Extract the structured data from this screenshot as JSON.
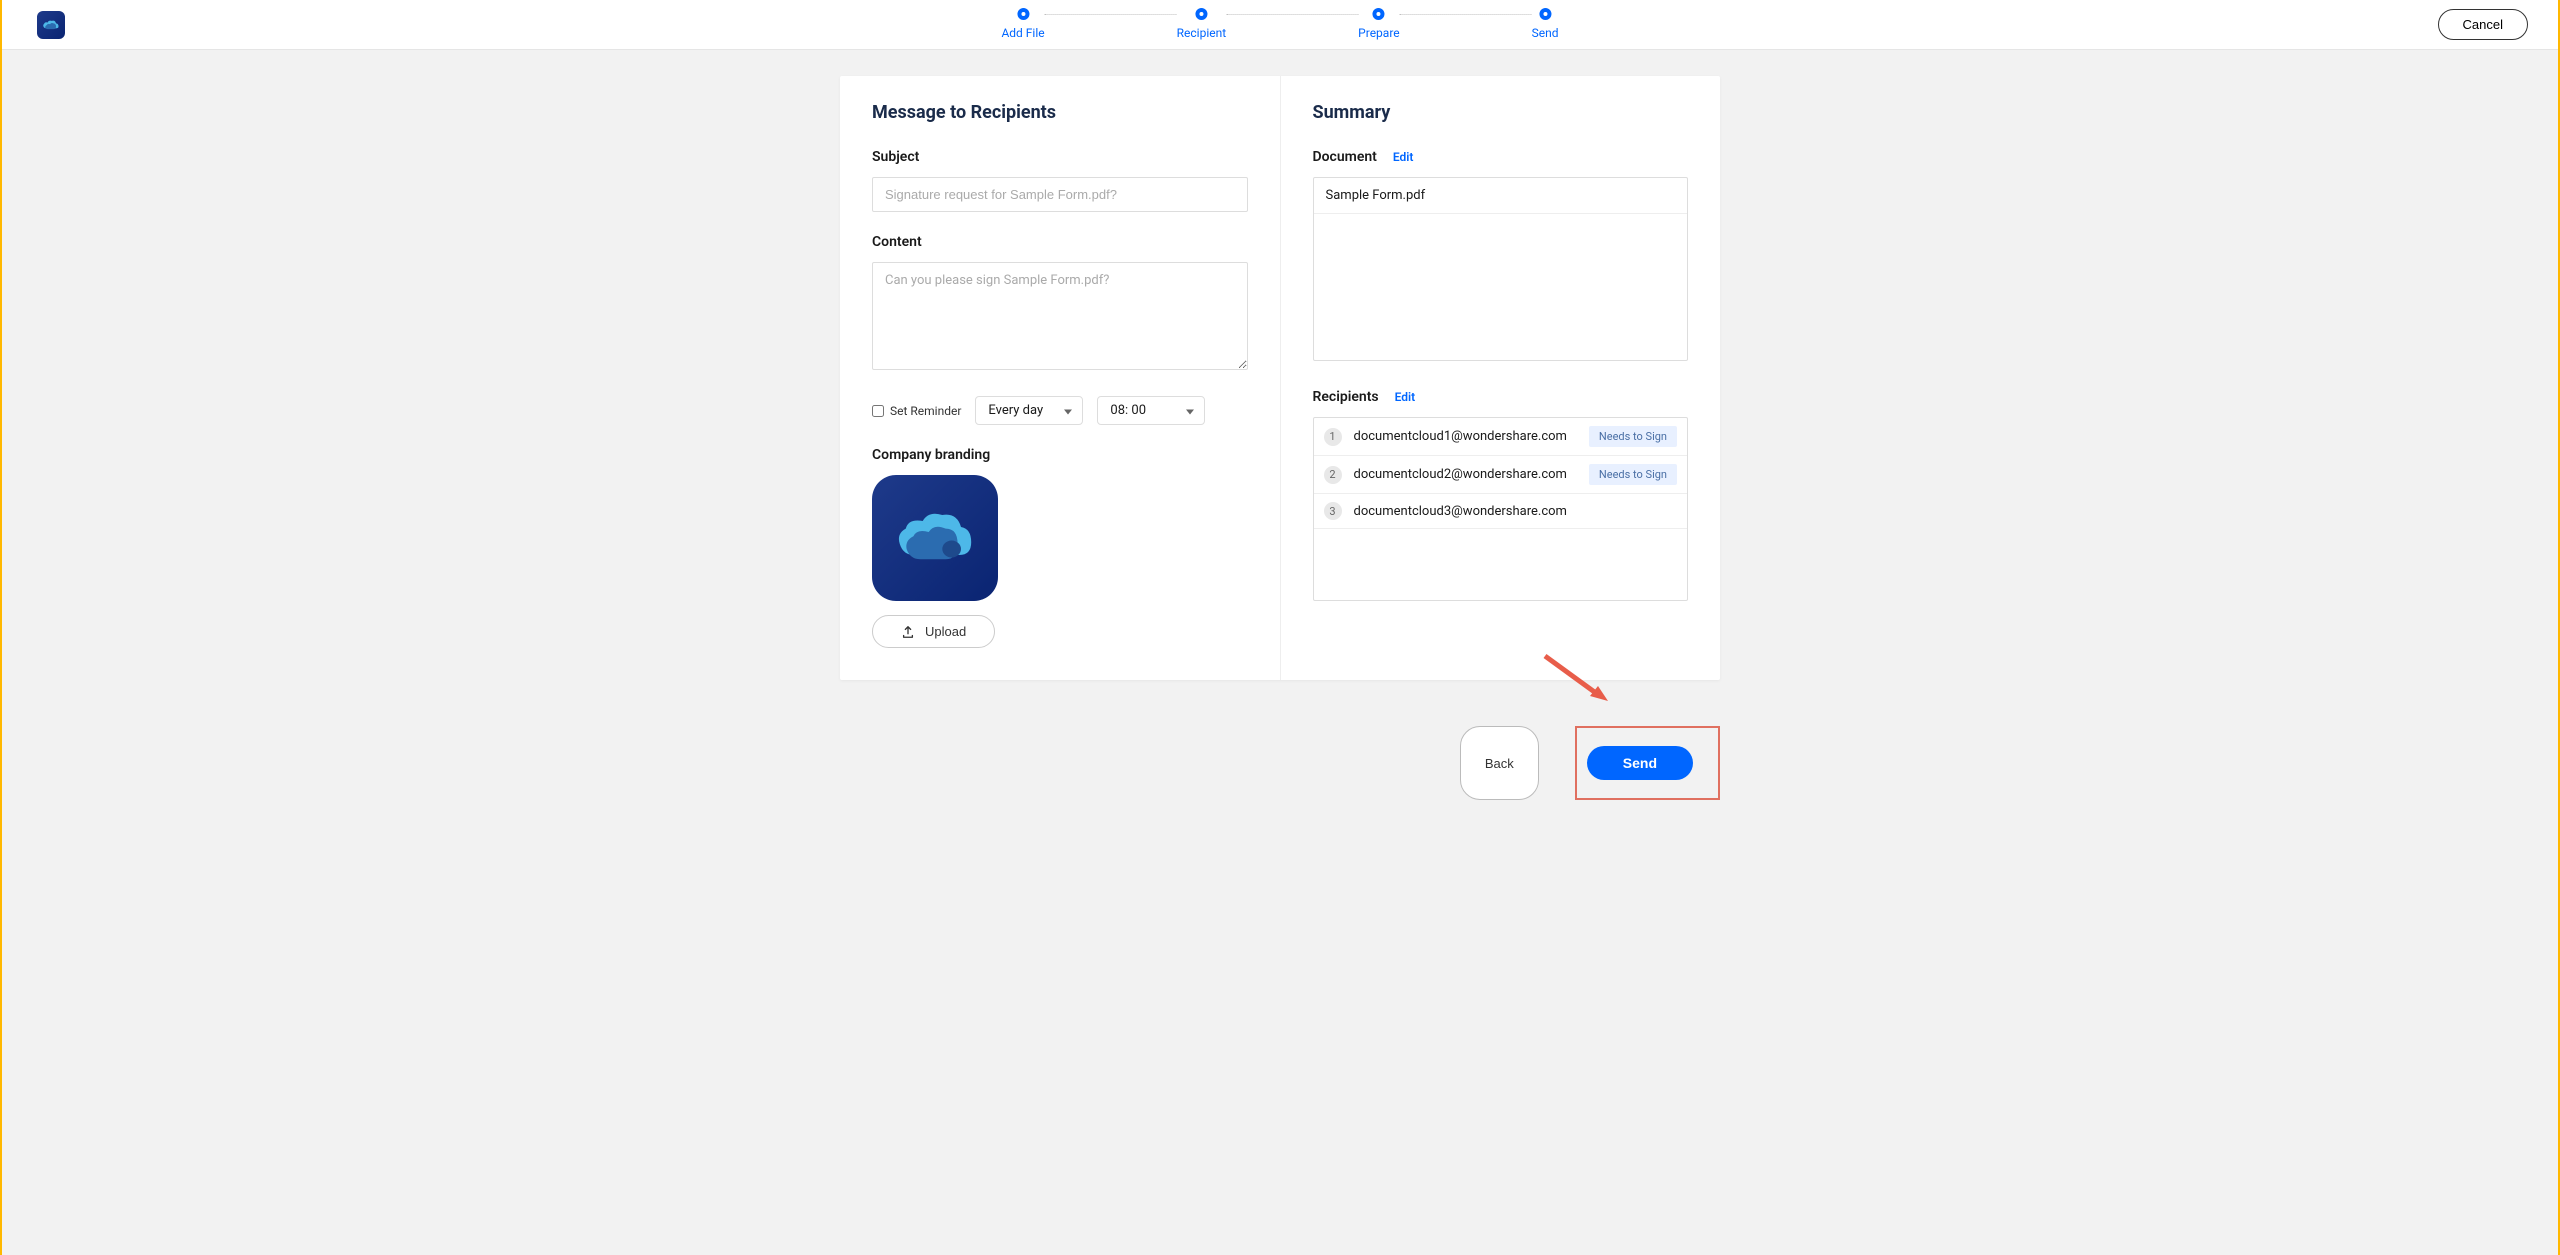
{
  "header": {
    "cancel_label": "Cancel",
    "steps": [
      {
        "label": "Add File"
      },
      {
        "label": "Recipient"
      },
      {
        "label": "Prepare"
      },
      {
        "label": "Send"
      }
    ]
  },
  "message": {
    "title": "Message to Recipients",
    "subject_label": "Subject",
    "subject_placeholder": "Signature request for Sample Form.pdf?",
    "content_label": "Content",
    "content_placeholder": "Can you please sign Sample Form.pdf?",
    "reminder_label": "Set Reminder",
    "reminder_freq": "Every day",
    "reminder_time": "08: 00",
    "branding_label": "Company branding",
    "upload_label": "Upload"
  },
  "summary": {
    "title": "Summary",
    "document_label": "Document",
    "edit_label": "Edit",
    "document_name": "Sample Form.pdf",
    "recipients_label": "Recipients",
    "recipients": [
      {
        "num": "1",
        "email": "documentcloud1@wondershare.com",
        "status": "Needs to Sign"
      },
      {
        "num": "2",
        "email": "documentcloud2@wondershare.com",
        "status": "Needs to Sign"
      },
      {
        "num": "3",
        "email": "documentcloud3@wondershare.com",
        "status": ""
      }
    ]
  },
  "footer": {
    "back_label": "Back",
    "send_label": "Send"
  }
}
